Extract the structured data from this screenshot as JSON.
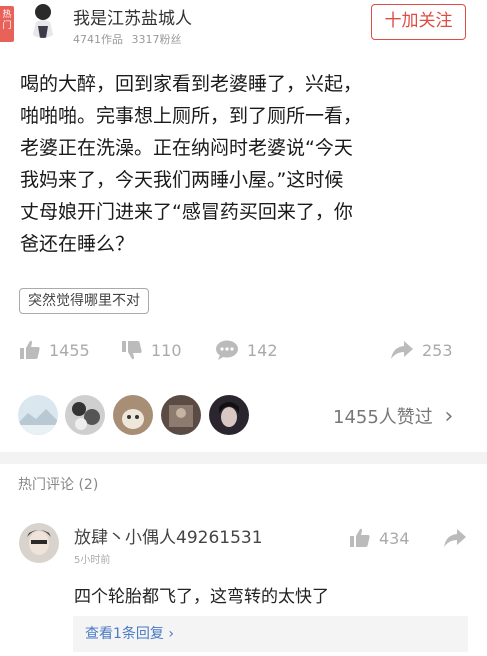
{
  "header": {
    "hot_tag": "热门",
    "author_name": "我是江苏盐城人",
    "works": "4741作品",
    "fans": "3317粉丝",
    "follow_label": "十加关注"
  },
  "post": {
    "lines": [
      "喝的大醉，回到家看到老婆睡了，兴起，",
      "啪啪啪。完事想上厕所，到了厕所一看，",
      "老婆正在洗澡。正在纳闷时老婆说“今天",
      "我妈来了，今天我们两睡小屋。”这时候",
      "丈母娘开门进来了“感冒药买回来了，你",
      "爸还在睡么？"
    ],
    "tag": "突然觉得哪里不对"
  },
  "stats": {
    "likes": "1455",
    "dislikes": "110",
    "comments": "142",
    "shares": "253"
  },
  "likers": {
    "summary": "1455人赞过",
    "chevron": "›"
  },
  "comments_section": {
    "title": "热门评论 (2)",
    "items": [
      {
        "user": "放肆丶小偶人49261531",
        "time": "5小时前",
        "likes": "434",
        "text": "四个轮胎都飞了，这弯转的太快了",
        "reply_link": "查看1条回复 ›"
      }
    ]
  },
  "colors": {
    "accent": "#e04b43",
    "link": "#4a7ac4",
    "icon_gray": "#bbbbbb"
  },
  "icons": [
    "thumbs-up-icon",
    "thumbs-down-icon",
    "comment-icon",
    "share-icon",
    "chevron-right-icon"
  ]
}
